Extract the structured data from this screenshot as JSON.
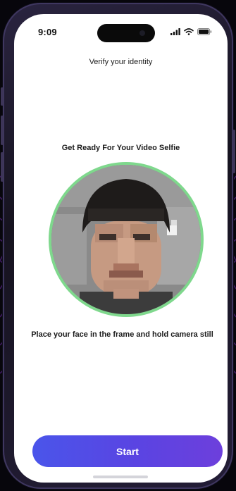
{
  "status_bar": {
    "time": "9:09",
    "icons": [
      "cellular-signal-icon",
      "wifi-icon",
      "battery-icon"
    ]
  },
  "verification": {
    "title": "Verify your identity",
    "heading": "Get Ready For Your Video Selfie",
    "instruction": "Place your face in the frame and hold camera still",
    "start_label": "Start"
  },
  "colors": {
    "frame_ring": "#7fd88d",
    "button_gradient_start": "#4a55ea",
    "button_gradient_end": "#6d3fdc",
    "backdrop_lines": "#7a2fb5"
  }
}
